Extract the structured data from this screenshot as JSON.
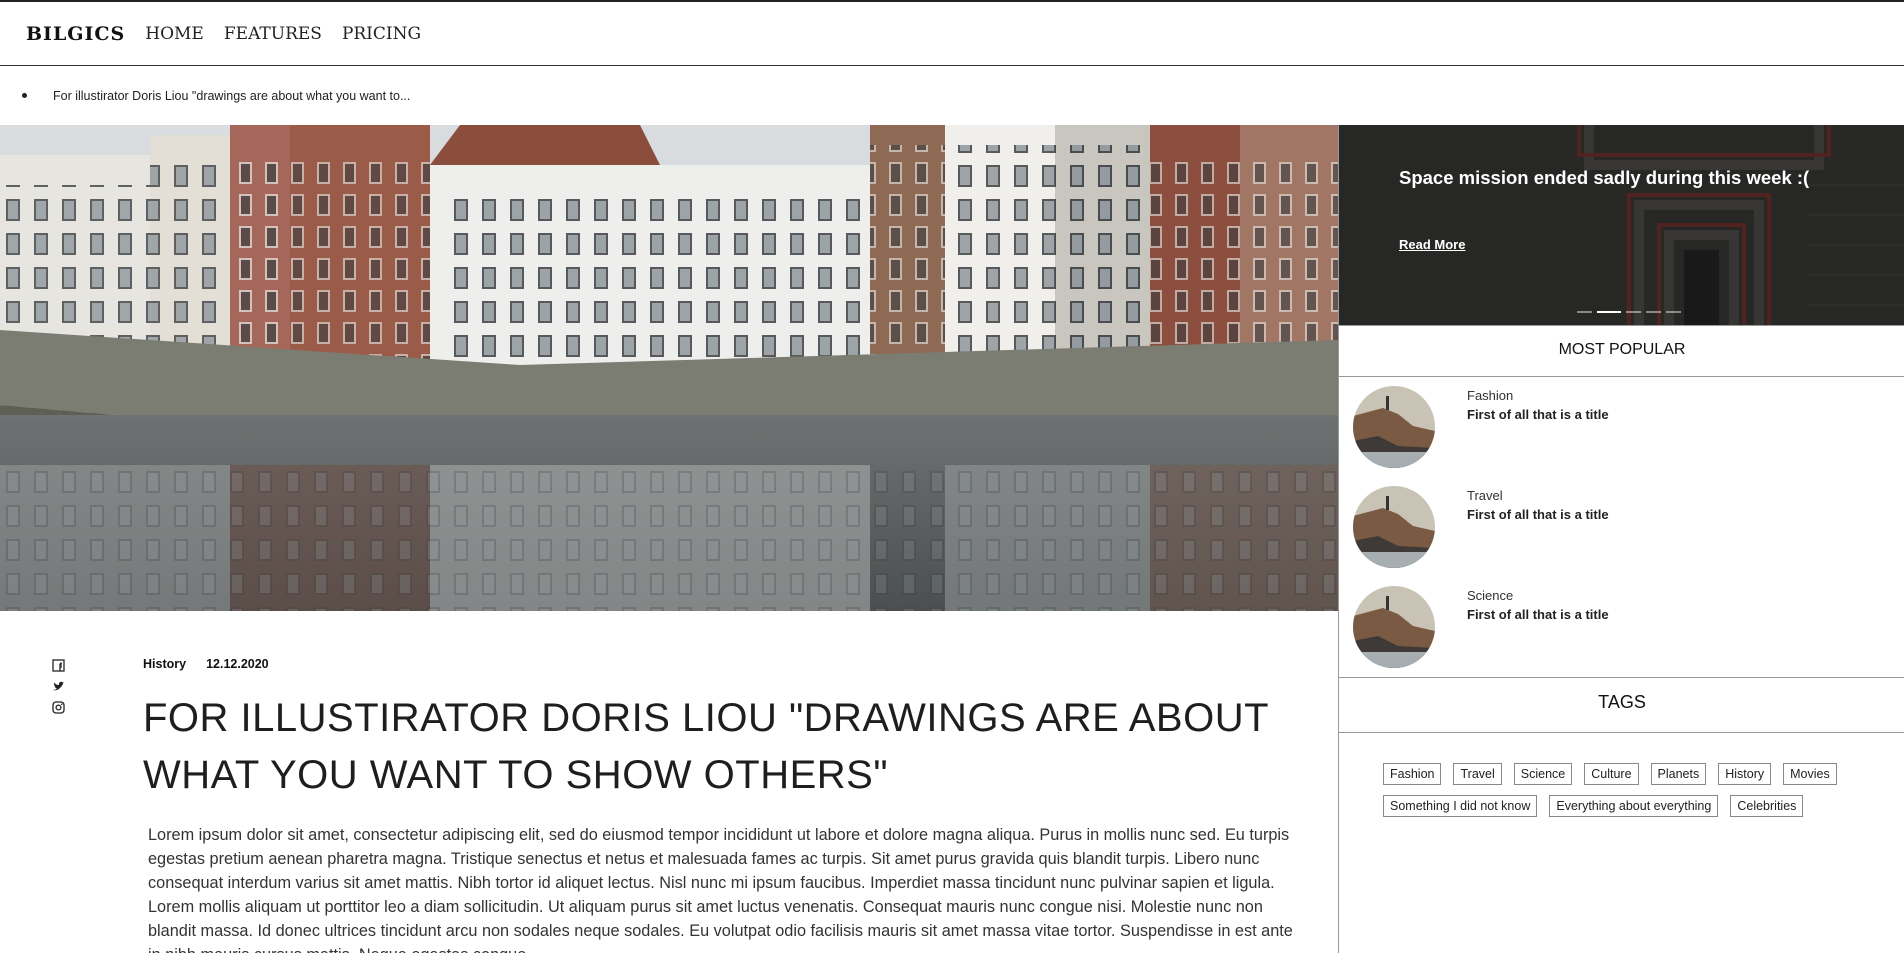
{
  "nav": {
    "brand": "BILGICS",
    "links": [
      "HOME",
      "FEATURES",
      "PRICING"
    ]
  },
  "ticker": {
    "text": "For illustirator Doris Liou \"drawings are about what you want to..."
  },
  "article": {
    "category": "History",
    "date": "12.12.2020",
    "title": "FOR ILLUSTIRATOR DORIS LIOU \"DRAWINGS ARE ABOUT WHAT YOU WANT TO SHOW OTHERS\"",
    "body": "Lorem ipsum dolor sit amet, consectetur adipiscing elit, sed do eiusmod tempor incididunt ut labore et dolore magna aliqua. Purus in mollis nunc sed. Eu turpis egestas pretium aenean pharetra magna. Tristique senectus et netus et malesuada fames ac turpis. Sit amet purus gravida quis blandit turpis. Libero nunc consequat interdum varius sit amet mattis. Nibh tortor id aliquet lectus. Nisl nunc mi ipsum faucibus. Imperdiet massa tincidunt nunc pulvinar sapien et ligula. Lorem mollis aliquam ut porttitor leo a diam sollicitudin. Ut aliquam purus sit amet luctus venenatis. Consequat mauris nunc congue nisi. Molestie nunc non blandit massa. Id donec ultrices tincidunt arcu non sodales neque sodales. Eu volutpat odio facilisis mauris sit amet massa vitae tortor. Suspendisse in est ante in nibh mauris cursus mattis. Neque egestas congue"
  },
  "social_icons": [
    "facebook-icon",
    "twitter-icon",
    "instagram-icon"
  ],
  "slider": {
    "title": "Space mission ended sadly during this week :(",
    "link_label": "Read More",
    "dots": 5,
    "active_dot": 1
  },
  "popular": {
    "heading": "MOST POPULAR",
    "items": [
      {
        "category": "Fashion",
        "title": "First of all that is a title"
      },
      {
        "category": "Travel",
        "title": "First of all that is a title"
      },
      {
        "category": "Science",
        "title": "First of all that is a title"
      }
    ]
  },
  "tags": {
    "heading": "TAGS",
    "items": [
      "Fashion",
      "Travel",
      "Science",
      "Culture",
      "Planets",
      "History",
      "Movies",
      "Something I did not know",
      "Everything about everything",
      "Celebrities"
    ]
  }
}
